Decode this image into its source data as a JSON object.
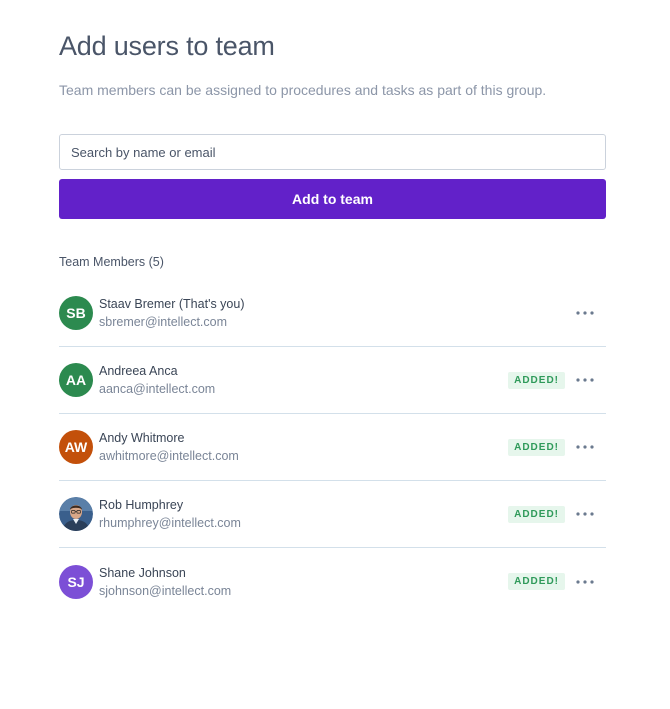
{
  "header": {
    "title": "Add users to team",
    "subtitle": "Team members can be assigned to procedures and tasks as part of this group."
  },
  "search": {
    "placeholder": "Search by name or email",
    "value": ""
  },
  "actions": {
    "add_label": "Add to team"
  },
  "members": {
    "heading": "Team Members (5)",
    "items": [
      {
        "initials": "SB",
        "name": "Staav Bremer (That's you)",
        "email": "sbremer@intellect.com",
        "badge": "",
        "avatar_color": "#2c8a4f"
      },
      {
        "initials": "AA",
        "name": "Andreea Anca",
        "email": "aanca@intellect.com",
        "badge": "ADDED!",
        "avatar_color": "#2c8a4f"
      },
      {
        "initials": "AW",
        "name": "Andy Whitmore",
        "email": "awhitmore@intellect.com",
        "badge": "ADDED!",
        "avatar_color": "#c3500a"
      },
      {
        "initials": "",
        "name": "Rob Humphrey",
        "email": "rhumphrey@intellect.com",
        "badge": "ADDED!",
        "avatar_color": "#3a5f8c"
      },
      {
        "initials": "SJ",
        "name": "Shane Johnson",
        "email": "sjohnson@intellect.com",
        "badge": "ADDED!",
        "avatar_color": "#7c4fd6"
      }
    ]
  },
  "icons": {
    "more": "more-horizontal-icon",
    "photo": "user-photo-icon"
  },
  "colors": {
    "primary": "#6221c9",
    "badge_bg": "#e6f6ec",
    "badge_text": "#2f9a5a",
    "divider": "#d3e0ea"
  }
}
